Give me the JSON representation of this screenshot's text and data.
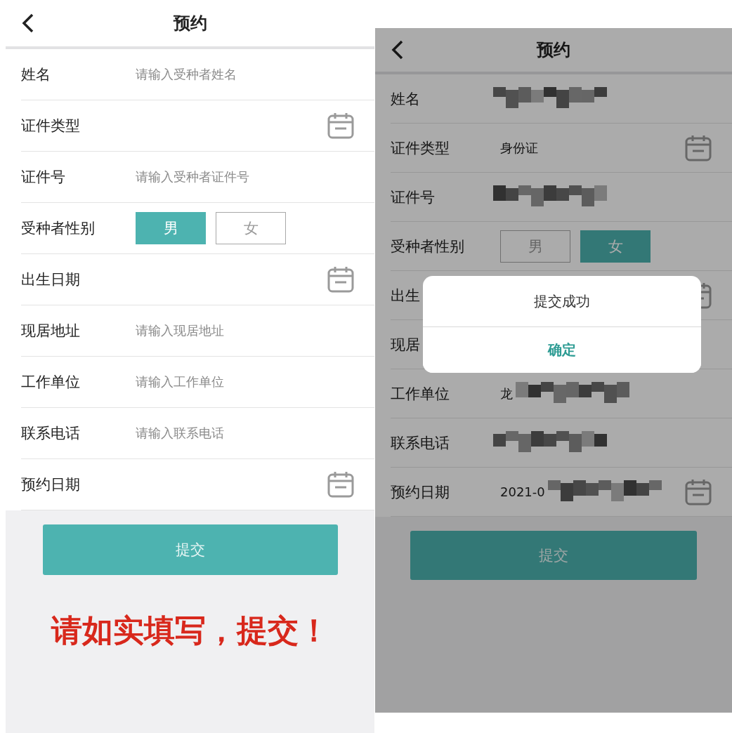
{
  "screens": [
    {
      "title": "预约",
      "dimmed": false,
      "fields": [
        {
          "kind": "text",
          "label": "姓名",
          "placeholder": "请输入受种者姓名"
        },
        {
          "kind": "picker",
          "label": "证件类型"
        },
        {
          "kind": "text",
          "label": "证件号",
          "placeholder": "请输入受种者证件号"
        },
        {
          "kind": "gender",
          "label": "受种者性别",
          "options": [
            {
              "label": "男",
              "selected": true
            },
            {
              "label": "女",
              "selected": false
            }
          ]
        },
        {
          "kind": "picker",
          "label": "出生日期"
        },
        {
          "kind": "text",
          "label": "现居地址",
          "placeholder": "请输入现居地址"
        },
        {
          "kind": "text",
          "label": "工作单位",
          "placeholder": "请输入工作单位"
        },
        {
          "kind": "text",
          "label": "联系电话",
          "placeholder": "请输入联系电话"
        },
        {
          "kind": "picker",
          "label": "预约日期"
        }
      ],
      "submit": "提交",
      "note": "请如实填写，提交！"
    },
    {
      "title": "预约",
      "dimmed": true,
      "fields": [
        {
          "kind": "text",
          "label": "姓名",
          "blurred": true
        },
        {
          "kind": "picker",
          "label": "证件类型",
          "value": "身份证"
        },
        {
          "kind": "text",
          "label": "证件号",
          "blurred": true
        },
        {
          "kind": "gender",
          "label": "受种者性别",
          "options": [
            {
              "label": "男",
              "selected": false
            },
            {
              "label": "女",
              "selected": true
            }
          ]
        },
        {
          "kind": "picker",
          "label": "出生"
        },
        {
          "kind": "text",
          "label": "现居"
        },
        {
          "kind": "text",
          "label": "工作单位",
          "value": "龙",
          "blurred": true
        },
        {
          "kind": "text",
          "label": "联系电话",
          "blurred": true
        },
        {
          "kind": "picker",
          "label": "预约日期",
          "value": "2021-0",
          "blurred": true
        }
      ],
      "submit": "提交",
      "dialog": {
        "message": "提交成功",
        "confirm": "确定"
      }
    }
  ]
}
